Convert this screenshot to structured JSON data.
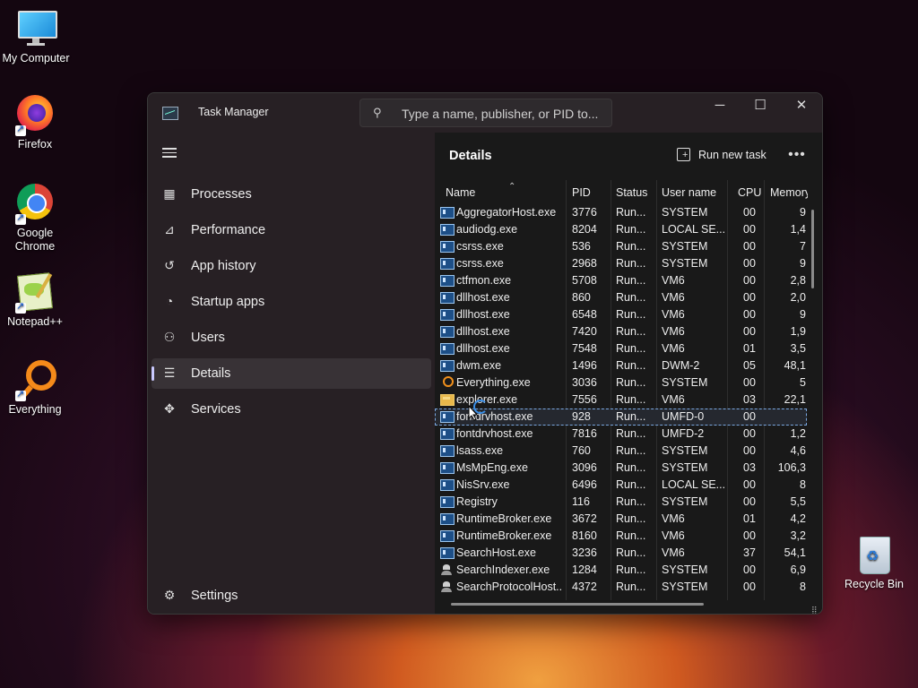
{
  "desktop": {
    "icons": [
      {
        "label": "My Computer"
      },
      {
        "label": "Firefox"
      },
      {
        "label": "Google Chrome"
      },
      {
        "label": "Notepad++"
      },
      {
        "label": "Everything"
      },
      {
        "label": "Recycle Bin"
      }
    ]
  },
  "window": {
    "title": "Task Manager",
    "search_placeholder": "Type a name, publisher, or PID to...",
    "controls": {
      "minimize": "─",
      "maximize": "☐",
      "close": "✕"
    }
  },
  "sidebar": {
    "items": [
      {
        "label": "Processes",
        "icon": "processes-grid-icon"
      },
      {
        "label": "Performance",
        "icon": "performance-chart-icon"
      },
      {
        "label": "App history",
        "icon": "app-history-icon"
      },
      {
        "label": "Startup apps",
        "icon": "startup-gauge-icon"
      },
      {
        "label": "Users",
        "icon": "users-icon"
      },
      {
        "label": "Details",
        "icon": "details-list-icon",
        "active": true
      },
      {
        "label": "Services",
        "icon": "services-puzzle-icon"
      }
    ],
    "settings_label": "Settings"
  },
  "main": {
    "title": "Details",
    "run_new_task_label": "Run new task",
    "more_label": "•••",
    "columns": [
      "Name",
      "PID",
      "Status",
      "User name",
      "CPU",
      "Memory"
    ],
    "rows": [
      {
        "name": "AggregatorHost.exe",
        "pid": "3776",
        "status": "Run...",
        "user": "SYSTEM",
        "cpu": "00",
        "mem": "9",
        "icon": "app"
      },
      {
        "name": "audiodg.exe",
        "pid": "8204",
        "status": "Run...",
        "user": "LOCAL SE...",
        "cpu": "00",
        "mem": "1,4",
        "icon": "app"
      },
      {
        "name": "csrss.exe",
        "pid": "536",
        "status": "Run...",
        "user": "SYSTEM",
        "cpu": "00",
        "mem": "7",
        "icon": "app"
      },
      {
        "name": "csrss.exe",
        "pid": "2968",
        "status": "Run...",
        "user": "SYSTEM",
        "cpu": "00",
        "mem": "9",
        "icon": "app"
      },
      {
        "name": "ctfmon.exe",
        "pid": "5708",
        "status": "Run...",
        "user": "VM6",
        "cpu": "00",
        "mem": "2,8",
        "icon": "app"
      },
      {
        "name": "dllhost.exe",
        "pid": "860",
        "status": "Run...",
        "user": "VM6",
        "cpu": "00",
        "mem": "2,0",
        "icon": "app"
      },
      {
        "name": "dllhost.exe",
        "pid": "6548",
        "status": "Run...",
        "user": "VM6",
        "cpu": "00",
        "mem": "9",
        "icon": "app"
      },
      {
        "name": "dllhost.exe",
        "pid": "7420",
        "status": "Run...",
        "user": "VM6",
        "cpu": "00",
        "mem": "1,9",
        "icon": "app"
      },
      {
        "name": "dllhost.exe",
        "pid": "7548",
        "status": "Run...",
        "user": "VM6",
        "cpu": "01",
        "mem": "3,5",
        "icon": "app"
      },
      {
        "name": "dwm.exe",
        "pid": "1496",
        "status": "Run...",
        "user": "DWM-2",
        "cpu": "05",
        "mem": "48,1",
        "icon": "app"
      },
      {
        "name": "Everything.exe",
        "pid": "3036",
        "status": "Run...",
        "user": "SYSTEM",
        "cpu": "00",
        "mem": "5",
        "icon": "magnifier"
      },
      {
        "name": "explorer.exe",
        "pid": "7556",
        "status": "Run...",
        "user": "VM6",
        "cpu": "03",
        "mem": "22,1",
        "icon": "folder"
      },
      {
        "name": "fontdrvhost.exe",
        "pid": "928",
        "status": "Run...",
        "user": "UMFD-0",
        "cpu": "00",
        "mem": "",
        "icon": "app",
        "selected": true
      },
      {
        "name": "fontdrvhost.exe",
        "pid": "7816",
        "status": "Run...",
        "user": "UMFD-2",
        "cpu": "00",
        "mem": "1,2",
        "icon": "app"
      },
      {
        "name": "lsass.exe",
        "pid": "760",
        "status": "Run...",
        "user": "SYSTEM",
        "cpu": "00",
        "mem": "4,6",
        "icon": "app"
      },
      {
        "name": "MsMpEng.exe",
        "pid": "3096",
        "status": "Run...",
        "user": "SYSTEM",
        "cpu": "03",
        "mem": "106,3",
        "icon": "app"
      },
      {
        "name": "NisSrv.exe",
        "pid": "6496",
        "status": "Run...",
        "user": "LOCAL SE...",
        "cpu": "00",
        "mem": "8",
        "icon": "app"
      },
      {
        "name": "Registry",
        "pid": "116",
        "status": "Run...",
        "user": "SYSTEM",
        "cpu": "00",
        "mem": "5,5",
        "icon": "app"
      },
      {
        "name": "RuntimeBroker.exe",
        "pid": "3672",
        "status": "Run...",
        "user": "VM6",
        "cpu": "01",
        "mem": "4,2",
        "icon": "app"
      },
      {
        "name": "RuntimeBroker.exe",
        "pid": "8160",
        "status": "Run...",
        "user": "VM6",
        "cpu": "00",
        "mem": "3,2",
        "icon": "app"
      },
      {
        "name": "SearchHost.exe",
        "pid": "3236",
        "status": "Run...",
        "user": "VM6",
        "cpu": "37",
        "mem": "54,1",
        "icon": "app"
      },
      {
        "name": "SearchIndexer.exe",
        "pid": "1284",
        "status": "Run...",
        "user": "SYSTEM",
        "cpu": "00",
        "mem": "6,9",
        "icon": "user"
      },
      {
        "name": "SearchProtocolHost....",
        "pid": "4372",
        "status": "Run...",
        "user": "SYSTEM",
        "cpu": "00",
        "mem": "8",
        "icon": "user"
      }
    ]
  }
}
